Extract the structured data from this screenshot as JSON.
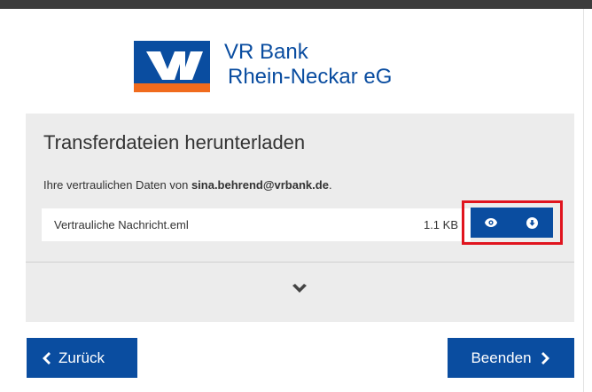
{
  "bank": {
    "name_line1": "VR Bank",
    "name_line2": "Rhein-Neckar eG",
    "colors": {
      "brand_blue": "#0a4da0",
      "brand_orange": "#f06b1d"
    }
  },
  "panel": {
    "title": "Transferdateien herunterladen",
    "subtitle_prefix": "Ihre vertraulichen Daten von ",
    "sender_email": "sina.behrend@vrbank.de",
    "subtitle_suffix": "."
  },
  "file": {
    "name": "Vertrauliche Nachricht.eml",
    "size": "1.1 KB",
    "actions": [
      "eye-icon",
      "download-icon"
    ]
  },
  "footer": {
    "back_label": "Zurück",
    "next_label": "Beenden"
  },
  "highlight_color": "#e0141e"
}
